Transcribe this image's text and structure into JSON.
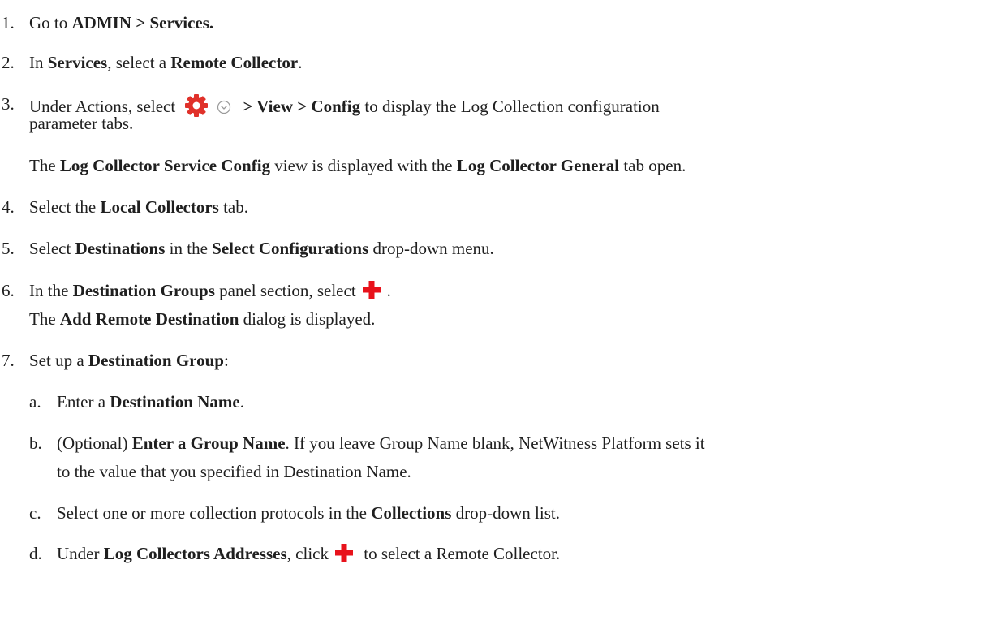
{
  "steps": [
    {
      "num": "1.",
      "a": "Go to ",
      "b": "ADMIN > Services."
    },
    {
      "num": "2.",
      "a": "In ",
      "b": "Services",
      "c": ", select a ",
      "d": "Remote Collector",
      "e": "."
    },
    {
      "num": "3.",
      "a": "Under Actions, select ",
      "b": "> View > Config",
      "c": " to display the Log Collection configuration",
      "cont": "parameter tabs."
    },
    {
      "note": true,
      "a": "The ",
      "b": "Log Collector Service Config",
      "c": " view is displayed with the ",
      "d": "Log Collector General",
      "e": " tab open."
    },
    {
      "num": "4.",
      "a": "Select the ",
      "b": "Local Collectors",
      "c": " tab."
    },
    {
      "num": "5.",
      "a": "Select ",
      "b": "Destinations",
      "c": " in the ",
      "d": "Select Configurations",
      "e": " drop-down menu."
    },
    {
      "num": "6.",
      "a": "In the ",
      "b": "Destination Groups",
      "c": " panel section, select",
      "e": "."
    },
    {
      "note": true,
      "a": "The ",
      "b": "Add Remote Destination",
      "c": " dialog is displayed."
    },
    {
      "num": "7.",
      "a": "Set up a ",
      "b": "Destination Group",
      "c": ":"
    }
  ],
  "substeps": [
    {
      "num": "a.",
      "a": "Enter a ",
      "b": "Destination Name",
      "c": "."
    },
    {
      "num": "b.",
      "a": "(Optional) ",
      "b": "Enter a Group Name",
      "c": ". If you leave Group Name blank, NetWitness Platform sets it",
      "cont": "to the value that you specified in Destination Name."
    },
    {
      "num": "c.",
      "a": "Select one or more collection protocols in the ",
      "b": "Collections",
      "c": " drop-down list."
    },
    {
      "num": "d.",
      "a": "Under ",
      "b": "Log Collectors Addresses",
      "c": ", click",
      "d": " to select a Remote Collector."
    }
  ],
  "icons": {
    "gear": "gear-icon",
    "chevron": "chevron-down-circle-icon",
    "plus": "add-plus-icon",
    "gear_color": "#e0312a",
    "plus_color": "#e8121b",
    "chevron_color": "#9a9a9a"
  }
}
